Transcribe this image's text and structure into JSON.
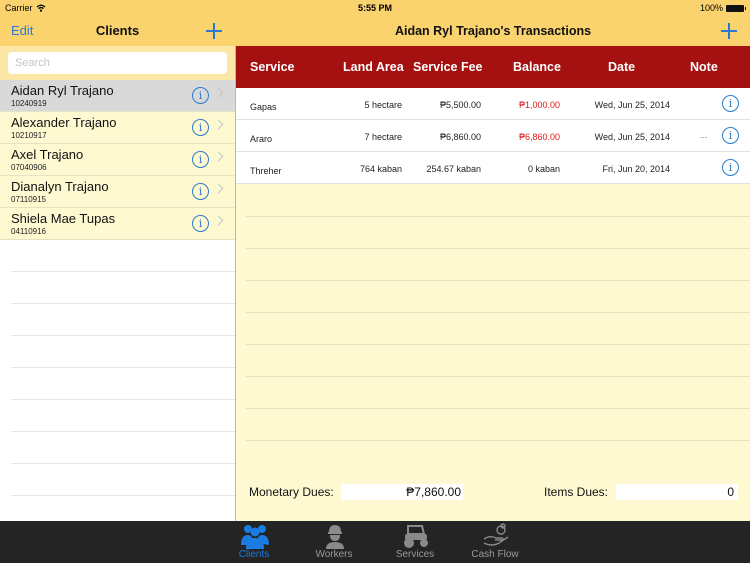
{
  "status_bar": {
    "carrier": "Carrier",
    "time": "5:55 PM",
    "battery": "100%"
  },
  "clients_panel": {
    "edit_label": "Edit",
    "title": "Clients",
    "search_placeholder": "Search",
    "search_value": "",
    "clients": [
      {
        "name": "Aidan Ryl Trajano",
        "id": "10240919",
        "selected": true
      },
      {
        "name": "Alexander Trajano",
        "id": "10210917",
        "selected": false
      },
      {
        "name": "Axel Trajano",
        "id": "07040906",
        "selected": false
      },
      {
        "name": "Dianalyn Trajano",
        "id": "07110915",
        "selected": false
      },
      {
        "name": "Shiela Mae Tupas",
        "id": "04110916",
        "selected": false
      }
    ]
  },
  "transactions_panel": {
    "title": "Aidan Ryl Trajano's Transactions",
    "columns": [
      "Service",
      "Land Area",
      "Service Fee",
      "Balance",
      "Date",
      "Note"
    ],
    "rows": [
      {
        "service": "Gapas",
        "land_area": "5 hectare",
        "service_fee": "₱5,500.00",
        "balance": "₱1,000.00",
        "balance_due": true,
        "date": "Wed, Jun 25, 2014",
        "note": ""
      },
      {
        "service": "Araro",
        "land_area": "7 hectare",
        "service_fee": "₱6,860.00",
        "balance": "₱6,860.00",
        "balance_due": true,
        "date": "Wed, Jun 25, 2014",
        "note": "..."
      },
      {
        "service": "Threher",
        "land_area": "764 kaban",
        "service_fee": "254.67 kaban",
        "balance": "0 kaban",
        "balance_due": false,
        "date": "Fri, Jun 20, 2014",
        "note": ""
      }
    ],
    "monetary_dues_label": "Monetary Dues:",
    "monetary_dues_value": "₱7,860.00",
    "items_dues_label": "Items Dues:",
    "items_dues_value": "0"
  },
  "tab_bar": {
    "tabs": [
      {
        "label": "Clients",
        "icon": "people-icon",
        "active": true
      },
      {
        "label": "Workers",
        "icon": "worker-hardhat-icon",
        "active": false
      },
      {
        "label": "Services",
        "icon": "tractor-icon",
        "active": false
      },
      {
        "label": "Cash Flow",
        "icon": "hand-money-icon",
        "active": false
      }
    ]
  },
  "colors": {
    "nav_bar": "#fad36f",
    "accent_blue": "#2a7bd0",
    "table_header": "#a51010",
    "balance_due": "#e01a1a",
    "panel_background": "#fff9d2",
    "tab_bar": "#242424"
  }
}
